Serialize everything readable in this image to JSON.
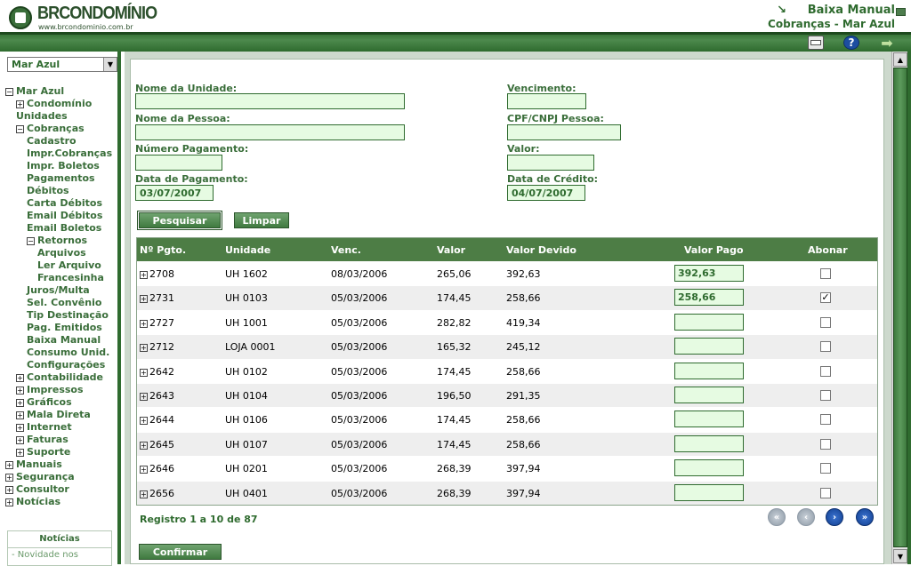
{
  "header": {
    "logo_text": "BRCONDOMÍNIO",
    "logo_url": "www.brcondominio.com.br",
    "title": "Baixa Manual",
    "subtitle": "Cobranças - Mar Azul"
  },
  "toolbar": {
    "print_icon": "printer-icon",
    "help_icon": "help-icon",
    "exit_icon": "exit-icon"
  },
  "sidebar": {
    "selected_condo": "Mar Azul",
    "tree": [
      {
        "label": "Mar Azul",
        "toggle": "−",
        "level": 0
      },
      {
        "label": "Condomínio",
        "toggle": "+",
        "level": 1
      },
      {
        "label": "Unidades",
        "toggle": "",
        "level": 1
      },
      {
        "label": "Cobranças",
        "toggle": "−",
        "level": 1
      },
      {
        "label": "Cadastro",
        "toggle": "",
        "level": 2
      },
      {
        "label": "Impr.Cobranças",
        "toggle": "",
        "level": 2
      },
      {
        "label": "Impr. Boletos",
        "toggle": "",
        "level": 2
      },
      {
        "label": "Pagamentos",
        "toggle": "",
        "level": 2
      },
      {
        "label": "Débitos",
        "toggle": "",
        "level": 2
      },
      {
        "label": "Carta Débitos",
        "toggle": "",
        "level": 2
      },
      {
        "label": "Email Débitos",
        "toggle": "",
        "level": 2
      },
      {
        "label": "Email Boletos",
        "toggle": "",
        "level": 2
      },
      {
        "label": "Retornos",
        "toggle": "−",
        "level": 2
      },
      {
        "label": "Arquivos",
        "toggle": "",
        "level": 3
      },
      {
        "label": "Ler Arquivo",
        "toggle": "",
        "level": 3
      },
      {
        "label": "Francesinha",
        "toggle": "",
        "level": 3
      },
      {
        "label": "Juros/Multa",
        "toggle": "",
        "level": 2
      },
      {
        "label": "Sel. Convênio",
        "toggle": "",
        "level": 2
      },
      {
        "label": "Tip Destinação",
        "toggle": "",
        "level": 2
      },
      {
        "label": "Pag. Emitidos",
        "toggle": "",
        "level": 2
      },
      {
        "label": "Baixa Manual",
        "toggle": "",
        "level": 2
      },
      {
        "label": "Consumo Unid.",
        "toggle": "",
        "level": 2
      },
      {
        "label": "Configurações",
        "toggle": "",
        "level": 2
      },
      {
        "label": "Contabilidade",
        "toggle": "+",
        "level": 1
      },
      {
        "label": "Impressos",
        "toggle": "+",
        "level": 1
      },
      {
        "label": "Gráficos",
        "toggle": "+",
        "level": 1
      },
      {
        "label": "Mala Direta",
        "toggle": "+",
        "level": 1
      },
      {
        "label": "Internet",
        "toggle": "+",
        "level": 1
      },
      {
        "label": "Faturas",
        "toggle": "+",
        "level": 1
      },
      {
        "label": "Suporte",
        "toggle": "+",
        "level": 1
      },
      {
        "label": "Manuais",
        "toggle": "+",
        "level": 0
      },
      {
        "label": "Segurança",
        "toggle": "+",
        "level": 0
      },
      {
        "label": "Consultor",
        "toggle": "+",
        "level": 0
      },
      {
        "label": "Notícias",
        "toggle": "+",
        "level": 0
      }
    ],
    "news_title": "Notícias",
    "news_item": "- Novidade nos"
  },
  "form": {
    "unit_name_label": "Nome da Unidade:",
    "unit_name_value": "",
    "person_name_label": "Nome da Pessoa:",
    "person_name_value": "",
    "payment_number_label": "Número Pagamento:",
    "payment_number_value": "",
    "payment_date_label": "Data de Pagamento:",
    "payment_date_value": "03/07/2007",
    "due_label": "Vencimento:",
    "due_value": "",
    "cpf_label": "CPF/CNPJ Pessoa:",
    "cpf_value": "",
    "value_label": "Valor:",
    "value_value": "",
    "credit_date_label": "Data de Crédito:",
    "credit_date_value": "04/07/2007",
    "search_label": "Pesquisar",
    "clear_label": "Limpar"
  },
  "table": {
    "columns": [
      "Nº Pgto.",
      "Unidade",
      "Venc.",
      "Valor",
      "Valor Devido",
      "Valor Pago",
      "Abonar"
    ],
    "rows": [
      {
        "num": "2708",
        "unit": "UH 1602",
        "due": "08/03/2006",
        "value": "265,06",
        "owed": "392,63",
        "paid": "392,63",
        "abonar": false
      },
      {
        "num": "2731",
        "unit": "UH 0103",
        "due": "05/03/2006",
        "value": "174,45",
        "owed": "258,66",
        "paid": "258,66",
        "abonar": true
      },
      {
        "num": "2727",
        "unit": "UH 1001",
        "due": "05/03/2006",
        "value": "282,82",
        "owed": "419,34",
        "paid": "",
        "abonar": false
      },
      {
        "num": "2712",
        "unit": "LOJA 0001",
        "due": "05/03/2006",
        "value": "165,32",
        "owed": "245,12",
        "paid": "",
        "abonar": false
      },
      {
        "num": "2642",
        "unit": "UH 0102",
        "due": "05/03/2006",
        "value": "174,45",
        "owed": "258,66",
        "paid": "",
        "abonar": false
      },
      {
        "num": "2643",
        "unit": "UH 0104",
        "due": "05/03/2006",
        "value": "196,50",
        "owed": "291,35",
        "paid": "",
        "abonar": false
      },
      {
        "num": "2644",
        "unit": "UH 0106",
        "due": "05/03/2006",
        "value": "174,45",
        "owed": "258,66",
        "paid": "",
        "abonar": false
      },
      {
        "num": "2645",
        "unit": "UH 0107",
        "due": "05/03/2006",
        "value": "174,45",
        "owed": "258,66",
        "paid": "",
        "abonar": false
      },
      {
        "num": "2646",
        "unit": "UH 0201",
        "due": "05/03/2006",
        "value": "268,39",
        "owed": "397,94",
        "paid": "",
        "abonar": false
      },
      {
        "num": "2656",
        "unit": "UH 0401",
        "due": "05/03/2006",
        "value": "268,39",
        "owed": "397,94",
        "paid": "",
        "abonar": false
      }
    ]
  },
  "pagination": {
    "info": "Registro 1 a 10 de 87",
    "first_icon": "first-page-icon",
    "prev_icon": "previous-page-icon",
    "next_icon": "next-page-icon",
    "last_icon": "last-page-icon"
  },
  "confirm_label": "Confirmar",
  "colors": {
    "brand_green": "#2f6b2f",
    "header_row": "#4d7d45",
    "input_bg": "#e6fbe2"
  }
}
